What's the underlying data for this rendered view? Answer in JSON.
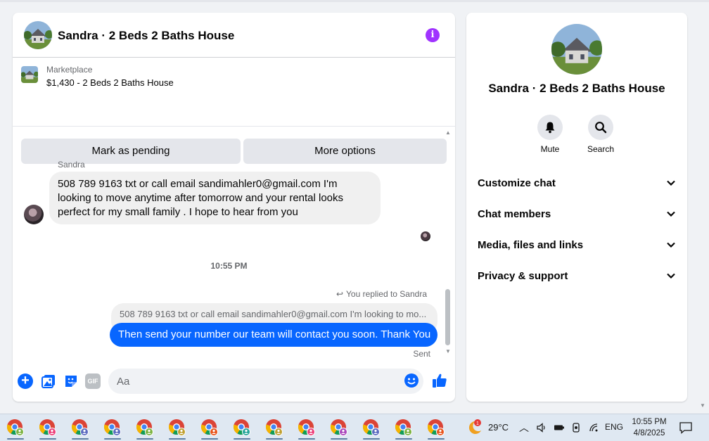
{
  "chat": {
    "title": "Sandra · 2 Beds 2 Baths House",
    "listing_source": "Marketplace",
    "listing_desc": "$1,430 - 2 Beds 2 Baths House",
    "btn_pending": "Mark as pending",
    "btn_more": "More options",
    "sender_name": "Sandra",
    "incoming_message": "508 789 9163  txt or call email sandimahler0@gmail.com I'm looking to move anytime after tomorrow and your rental looks perfect for my small family . I hope to hear from you",
    "timestamp": "10:55 PM",
    "replied_label": "You replied to Sandra",
    "quoted_message": "508 789 9163  txt or call email sandimahler0@gmail.com I'm looking to mo...",
    "outgoing_message": "Then send your number our team will contact you soon. Thank You",
    "sent_status": "Sent",
    "input_placeholder": "Aa",
    "gif_label": "GIF"
  },
  "info_panel": {
    "title": "Sandra · 2 Beds 2 Baths House",
    "mute_label": "Mute",
    "search_label": "Search",
    "sections": [
      "Customize chat",
      "Chat members",
      "Media, files and links",
      "Privacy & support"
    ]
  },
  "taskbar": {
    "weather_badge": "1",
    "temperature": "29°C",
    "language": "ENG",
    "time": "10:55 PM",
    "date": "4/8/2025",
    "apps": [
      {
        "icon": "chrome-profile-icon",
        "badge_color": "#7cb342"
      },
      {
        "icon": "chrome-profile-icon",
        "badge_color": "#ec407a"
      },
      {
        "icon": "chrome-profile-icon",
        "badge_color": "#5c6bc0"
      },
      {
        "icon": "chrome-profile-icon",
        "badge_color": "#5c6bc0"
      },
      {
        "icon": "chrome-profile-icon",
        "badge_color": "#7cb342"
      },
      {
        "icon": "chrome-profile-icon",
        "badge_color": "#c0a030"
      },
      {
        "icon": "chrome-profile-icon",
        "badge_color": "#e8541c"
      },
      {
        "icon": "chrome-profile-icon",
        "badge_color": "#26a69a"
      },
      {
        "icon": "chrome-profile-icon",
        "badge_color": "#c0a030"
      },
      {
        "icon": "chrome-profile-icon",
        "badge_color": "#ec407a"
      },
      {
        "icon": "chrome-profile-icon",
        "badge_color": "#ab47bc"
      },
      {
        "icon": "chrome-profile-icon",
        "badge_color": "#5c6bc0"
      },
      {
        "icon": "chrome-profile-icon",
        "badge_color": "#7cb342"
      },
      {
        "icon": "chrome-profile-icon",
        "badge_color": "#e8541c"
      }
    ]
  },
  "colors": {
    "messenger_blue": "#0866ff",
    "info_purple": "#a033ff",
    "bubble_gray": "#f0f0f0"
  }
}
